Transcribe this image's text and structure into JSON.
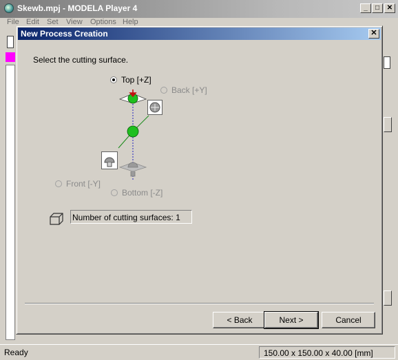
{
  "app": {
    "title": "Skewb.mpj - MODELA Player 4",
    "menu": [
      "File",
      "Edit",
      "Set",
      "View",
      "Options",
      "Help"
    ],
    "window_controls": [
      "_",
      "□",
      "✕"
    ]
  },
  "dialog": {
    "title": "New Process Creation",
    "close_label": "✕",
    "prompt": "Select the cutting surface.",
    "surfaces": {
      "top": {
        "label": "Top [+Z]",
        "checked": true,
        "enabled": true
      },
      "back": {
        "label": "Back [+Y]",
        "checked": false,
        "enabled": false
      },
      "front": {
        "label": "Front [-Y]",
        "checked": false,
        "enabled": false
      },
      "bottom": {
        "label": "Bottom [-Z]",
        "checked": false,
        "enabled": false
      }
    },
    "surface_count_text": "Number of cutting surfaces: 1",
    "buttons": {
      "back": "< Back",
      "next": "Next >",
      "cancel": "Cancel"
    }
  },
  "statusbar": {
    "status": "Ready",
    "dimensions": "150.00 x 150.00 x 40.00 [mm]"
  },
  "colors": {
    "dialog_title_start": "#0a246a",
    "dialog_title_end": "#a6caf0",
    "sphere": "#1fbf1f",
    "arrow": "#c01010"
  }
}
